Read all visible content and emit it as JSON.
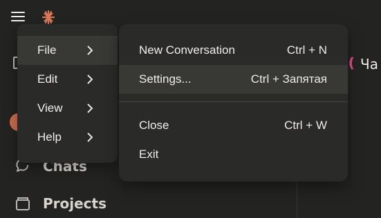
{
  "app": {
    "window_title_partial": "Ча"
  },
  "topbar": {
    "menu_icon": "hamburger-icon",
    "logo_icon": "claude-logo-icon"
  },
  "sidebar": {
    "items": [
      {
        "label": "Chats",
        "icon": "chats-icon"
      },
      {
        "label": "Projects",
        "icon": "projects-icon"
      }
    ]
  },
  "menu": {
    "items": [
      {
        "label": "File",
        "active": true
      },
      {
        "label": "Edit",
        "active": false
      },
      {
        "label": "View",
        "active": false
      },
      {
        "label": "Help",
        "active": false
      }
    ]
  },
  "file_submenu": {
    "items": [
      {
        "label": "New Conversation",
        "shortcut": "Ctrl + N"
      },
      {
        "label": "Settings...",
        "shortcut": "Ctrl + Запятая"
      },
      {
        "label": "Close",
        "shortcut": "Ctrl + W"
      },
      {
        "label": "Exit",
        "shortcut": ""
      }
    ]
  },
  "colors": {
    "background": "#232322",
    "menu_background": "#2a2a29",
    "menu_active": "#383835",
    "avatar": "#c96d4d",
    "logo_accent": "#d97757",
    "title_icon_accent": "#e24a8a"
  }
}
